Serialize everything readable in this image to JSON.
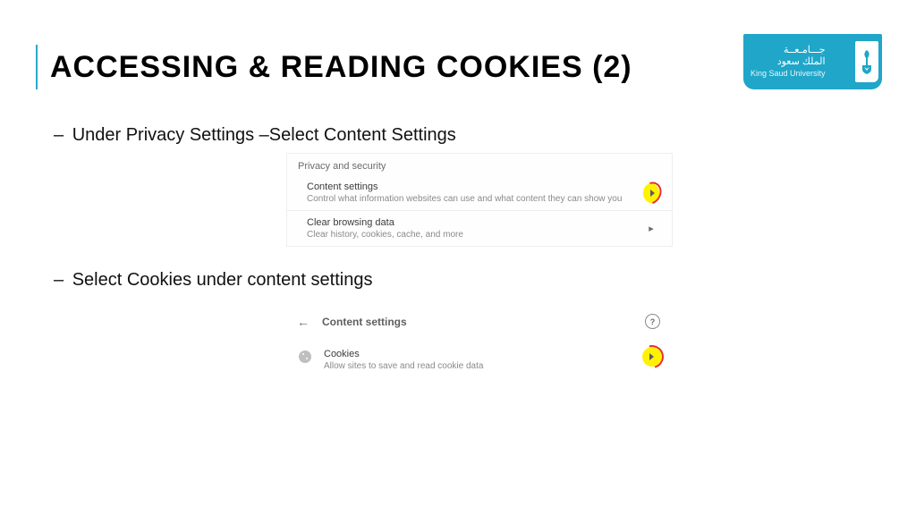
{
  "title": "ACCESSING & READING COOKIES (2)",
  "university": {
    "arabic1": "جـــامـعــة",
    "arabic2": "الملك سعود",
    "english": "King Saud University"
  },
  "bullets": {
    "b1": "Under Privacy Settings –Select Content Settings",
    "b2": "Select Cookies under content settings"
  },
  "shot1": {
    "section": "Privacy and security",
    "row1": {
      "label": "Content settings",
      "sub": "Control what information websites can use and what content they can show you"
    },
    "row2": {
      "label": "Clear browsing data",
      "sub": "Clear history, cookies, cache, and more"
    }
  },
  "shot2": {
    "header": "Content settings",
    "row": {
      "label": "Cookies",
      "sub": "Allow sites to save and read cookie data"
    }
  }
}
